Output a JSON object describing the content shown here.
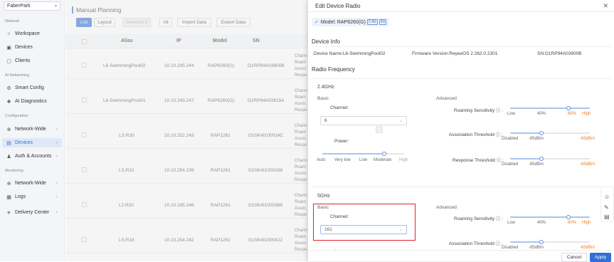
{
  "sidebar": {
    "org": "FaberPark",
    "sections": [
      "Network",
      "AI Networking",
      "Configuration",
      "Monitoring"
    ],
    "items": [
      {
        "label": "Workspace",
        "icon": "home-icon"
      },
      {
        "label": "Devices",
        "icon": "devices-icon"
      },
      {
        "label": "Clients",
        "icon": "clients-icon"
      },
      {
        "label": "Smart Config",
        "icon": "smart-config-icon"
      },
      {
        "label": "AI Diagnostics",
        "icon": "ai-diagnostics-icon"
      },
      {
        "label": "Network-Wide",
        "icon": "network-icon"
      },
      {
        "label": "Devices",
        "icon": "devices-icon"
      },
      {
        "label": "Auth & Accounts",
        "icon": "auth-icon"
      },
      {
        "label": "Network-Wide",
        "icon": "network-icon"
      },
      {
        "label": "Logs",
        "icon": "logs-icon"
      },
      {
        "label": "Delivery Center",
        "icon": "delivery-icon"
      }
    ]
  },
  "main": {
    "title": "Manual Planning",
    "toolbar": {
      "list": "List",
      "layout": "Layout",
      "selected": "Selected",
      "selected_count": "0",
      "all": "All",
      "import": "Import Data",
      "export": "Export Data"
    },
    "columns": [
      "Alias",
      "IP",
      "Model",
      "SN"
    ],
    "rows": [
      {
        "alias": "L6-SwimmingPool02",
        "ip": "10.10.245.244",
        "model": "RAP6260(G)",
        "sn": "G1RP94A03800B",
        "ch": [
          "Chann",
          "Roam",
          "Assoc",
          "Respo"
        ]
      },
      {
        "alias": "L6-SwimmingPool01",
        "ip": "10.10.243.247",
        "model": "RAP6260(G)",
        "sn": "G1RP94A038154",
        "ch": [
          "Chann",
          "Roam",
          "Assoc",
          "Respo"
        ]
      },
      {
        "alias": "LS.R30",
        "ip": "10.10.252.243",
        "model": "RAP1261",
        "sn": "G1SK4I100014C",
        "ch": [
          "Chann",
          "Roam",
          "Assoc",
          "Respo"
        ]
      },
      {
        "alias": "LS.R31",
        "ip": "10.10.254.239",
        "model": "RAP1261",
        "sn": "G1SK4I1000198",
        "ch": [
          "Chann",
          "Roam",
          "Assoc",
          "Respo"
        ]
      },
      {
        "alias": "L2.R20",
        "ip": "10.10.245.246",
        "model": "RAP1261",
        "sn": "G1SK4I1000388",
        "ch": [
          "Chann",
          "Roam",
          "Assoc",
          "Respo"
        ]
      },
      {
        "alias": "LS.R16",
        "ip": "10.10.254.242",
        "model": "RAP1261",
        "sn": "G1SK4I1000422",
        "ch": [
          "Chann",
          "Roam",
          "Assoc",
          "Respo"
        ]
      }
    ]
  },
  "drawer": {
    "title": "Edit Device Radio",
    "model_label": "Model: RAP6260(G)",
    "model_tags": [
      "2.4G",
      "5G"
    ],
    "device_info": "Device Info",
    "device_name": "Device Name:L6-SwimmingPool02",
    "firmware": "Firmware Version:ReyeeOS 2.262.0.2301",
    "sn": "SN:G1RP94A03800B",
    "radio_frequency": "Radio Frequency",
    "band24": {
      "title": "2.4GHz",
      "basic": "Basic",
      "advanced": "Advanced",
      "channel_label": "Channel:",
      "channel_value": "6",
      "power_label": "Power:",
      "power_ticks": [
        "Auto",
        "Very low",
        "Low",
        "Moderate",
        "High"
      ],
      "power_level": "Moderate",
      "roaming_label": "Roaming Sensitivity",
      "roaming_ticks": [
        "Low",
        "40%",
        "80%",
        "High"
      ],
      "roaming_value": "80%",
      "assoc_label": "Association Threshold",
      "assoc_ticks": [
        "Disabled",
        "-85dBm",
        "-65dBm"
      ],
      "response_label": "Response Threshold",
      "response_ticks": [
        "Disabled",
        "-85dBm",
        "-65dBm"
      ]
    },
    "band5": {
      "title": "5GHz",
      "basic": "Basic",
      "advanced": "Advanced",
      "channel_label": "Channel:",
      "channel_value": "161",
      "roaming_label": "Roaming Sensitivity",
      "roaming_ticks": [
        "Low",
        "40%",
        "80%",
        "High"
      ],
      "roaming_value": "80%",
      "assoc_label": "Association Threshold",
      "assoc_ticks": [
        "Disabled",
        "-85dBm",
        "-65dBm"
      ]
    },
    "cancel": "Cancel",
    "apply": "Apply"
  },
  "colors": {
    "accent": "#2f6fd6",
    "highlight": "#e0212a",
    "orange": "#ef7e1e"
  }
}
